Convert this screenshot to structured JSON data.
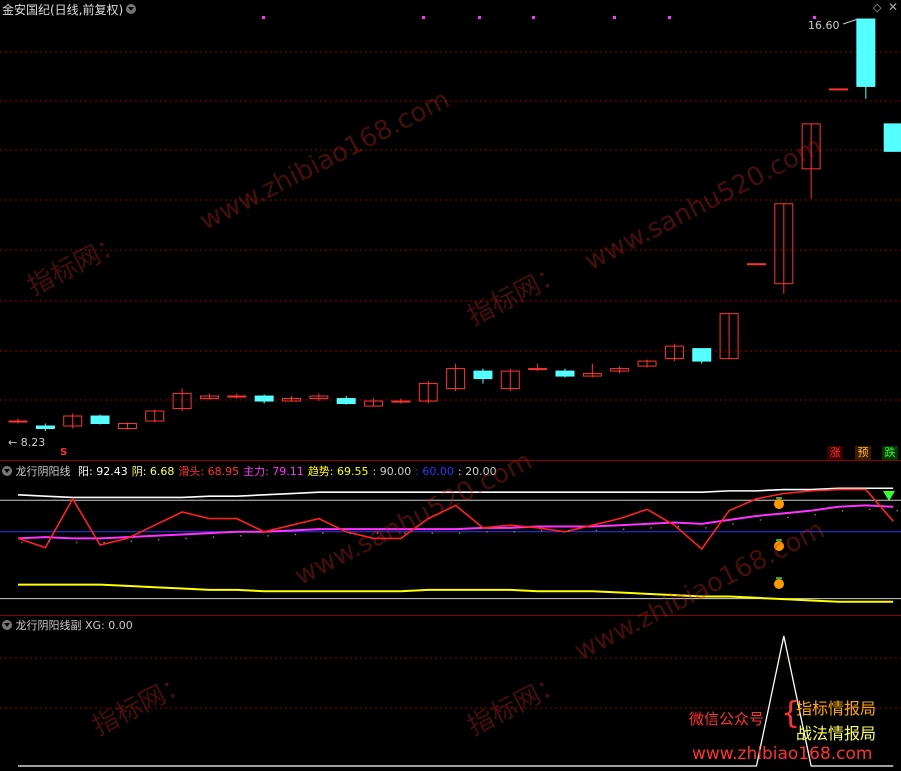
{
  "header": {
    "title": "金安国纪(日线,前复权)",
    "max_price_label": "16.60",
    "min_price_label": "8.23"
  },
  "tags": {
    "zhang": "涨",
    "yu": "预",
    "die": "跌"
  },
  "buy_marker": "S",
  "indicator1": {
    "name": "龙行阴阳线",
    "items": [
      {
        "key": "阳",
        "label": "阳: ",
        "value": "92.43",
        "color": "#ffffff"
      },
      {
        "key": "阴",
        "label": "阴: ",
        "value": "6.68",
        "color": "#ffff66"
      },
      {
        "key": "滑头",
        "label": "滑头: ",
        "value": "68.95",
        "color": "#ff3333"
      },
      {
        "key": "主力",
        "label": "主力: ",
        "value": "79.11",
        "color": "#ff33ff"
      },
      {
        "key": "趋势",
        "label": "趋势: ",
        "value": "69.55",
        "color": "#ffff00"
      },
      {
        "key": "l90",
        "label": ": ",
        "value": "90.00",
        "color": "#cccccc"
      },
      {
        "key": "l60",
        "label": ": ",
        "value": "60.00",
        "color": "#3333ff"
      },
      {
        "key": "l20",
        "label": ": ",
        "value": "20.00",
        "color": "#cccccc"
      }
    ]
  },
  "indicator2": {
    "name": "龙行阴阳线副",
    "xg_label": "XG: ",
    "xg_value": "0.00"
  },
  "promo": {
    "wechat": "微信公众号",
    "brace": "{",
    "line1": "指标情报局",
    "line2": "战法情报局",
    "url": "www.zhibiao168.com"
  },
  "watermarks": [
    "www.zhibiao168.com",
    "指标网：",
    "www.sanhu520.com",
    "指标网：",
    "www.sanhu520.com",
    "www.zhibiao168.com",
    "指标网：",
    "指标网："
  ],
  "colors": {
    "up": "#ff3333",
    "down": "#54ffff",
    "grid": "#8b0000"
  },
  "chart_data": {
    "type": "candlestick",
    "ylim": [
      8.23,
      16.6
    ],
    "candles": [
      {
        "o": 8.55,
        "c": 8.55,
        "h": 8.6,
        "l": 8.5,
        "up": true
      },
      {
        "o": 8.45,
        "c": 8.4,
        "h": 8.5,
        "l": 8.35,
        "up": false
      },
      {
        "o": 8.45,
        "c": 8.65,
        "h": 8.7,
        "l": 8.4,
        "up": true
      },
      {
        "o": 8.65,
        "c": 8.5,
        "h": 8.68,
        "l": 8.48,
        "up": false
      },
      {
        "o": 8.4,
        "c": 8.5,
        "h": 8.52,
        "l": 8.38,
        "up": true
      },
      {
        "o": 8.55,
        "c": 8.75,
        "h": 8.78,
        "l": 8.52,
        "up": true
      },
      {
        "o": 8.8,
        "c": 9.1,
        "h": 9.2,
        "l": 8.75,
        "up": true
      },
      {
        "o": 9.0,
        "c": 9.05,
        "h": 9.1,
        "l": 8.98,
        "up": true
      },
      {
        "o": 9.05,
        "c": 9.05,
        "h": 9.1,
        "l": 9.0,
        "up": true
      },
      {
        "o": 9.05,
        "c": 8.95,
        "h": 9.08,
        "l": 8.9,
        "up": false
      },
      {
        "o": 8.95,
        "c": 9.0,
        "h": 9.05,
        "l": 8.95,
        "up": true
      },
      {
        "o": 9.0,
        "c": 9.05,
        "h": 9.1,
        "l": 8.95,
        "up": true
      },
      {
        "o": 9.0,
        "c": 8.9,
        "h": 9.05,
        "l": 8.88,
        "up": false
      },
      {
        "o": 8.85,
        "c": 8.95,
        "h": 9.0,
        "l": 8.85,
        "up": true
      },
      {
        "o": 8.95,
        "c": 8.95,
        "h": 9.0,
        "l": 8.9,
        "up": true
      },
      {
        "o": 8.95,
        "c": 9.3,
        "h": 9.35,
        "l": 8.9,
        "up": true
      },
      {
        "o": 9.2,
        "c": 9.6,
        "h": 9.7,
        "l": 9.15,
        "up": true
      },
      {
        "o": 9.55,
        "c": 9.4,
        "h": 9.6,
        "l": 9.3,
        "up": false
      },
      {
        "o": 9.2,
        "c": 9.55,
        "h": 9.6,
        "l": 9.15,
        "up": true
      },
      {
        "o": 9.6,
        "c": 9.6,
        "h": 9.7,
        "l": 9.55,
        "up": true
      },
      {
        "o": 9.55,
        "c": 9.45,
        "h": 9.6,
        "l": 9.42,
        "up": false
      },
      {
        "o": 9.45,
        "c": 9.5,
        "h": 9.7,
        "l": 9.42,
        "up": true
      },
      {
        "o": 9.55,
        "c": 9.6,
        "h": 9.65,
        "l": 9.5,
        "up": true
      },
      {
        "o": 9.65,
        "c": 9.75,
        "h": 9.78,
        "l": 9.62,
        "up": true
      },
      {
        "o": 9.8,
        "c": 10.05,
        "h": 10.1,
        "l": 9.75,
        "up": true
      },
      {
        "o": 10.0,
        "c": 9.75,
        "h": 10.0,
        "l": 9.7,
        "up": false
      },
      {
        "o": 9.8,
        "c": 10.7,
        "h": 10.7,
        "l": 9.8,
        "up": true
      },
      {
        "o": 11.7,
        "c": 11.7,
        "h": 11.7,
        "l": 11.7,
        "up": true
      },
      {
        "o": 11.3,
        "c": 12.9,
        "h": 12.9,
        "l": 11.1,
        "up": true
      },
      {
        "o": 13.6,
        "c": 14.5,
        "h": 14.5,
        "l": 13.0,
        "up": true
      },
      {
        "o": 15.2,
        "c": 15.2,
        "h": 15.2,
        "l": 15.2,
        "up": true
      },
      {
        "o": 16.6,
        "c": 15.25,
        "h": 16.6,
        "l": 15.0,
        "up": false
      },
      {
        "o": 14.5,
        "c": 13.95,
        "h": 14.5,
        "l": 13.95,
        "up": false
      }
    ],
    "ind1_series": {
      "white": [
        88,
        87,
        86,
        86,
        86,
        86,
        86,
        87,
        87,
        88,
        89,
        90,
        90,
        90,
        90,
        90,
        90,
        90,
        90,
        90,
        90,
        90,
        90,
        90,
        90,
        90,
        91,
        91,
        92,
        92,
        93,
        93,
        93
      ],
      "red": [
        55,
        48,
        85,
        50,
        55,
        65,
        75,
        70,
        70,
        60,
        65,
        70,
        60,
        55,
        55,
        70,
        80,
        63,
        65,
        63,
        60,
        65,
        70,
        77,
        65,
        47,
        76,
        85,
        89,
        91,
        92,
        92,
        68
      ],
      "magenta": [
        55,
        56,
        55,
        55,
        56,
        57,
        58,
        59,
        60,
        60,
        61,
        62,
        62,
        62,
        62,
        62,
        62,
        63,
        63,
        64,
        64,
        64,
        65,
        66,
        67,
        66,
        69,
        72,
        74,
        76,
        79,
        80,
        79
      ],
      "yellow": [
        20,
        20,
        20,
        20,
        19,
        18,
        17,
        16,
        16,
        15,
        15,
        15,
        15,
        15,
        15,
        16,
        16,
        16,
        16,
        15,
        15,
        15,
        14,
        13,
        12,
        11,
        11,
        10,
        9,
        8,
        7,
        7,
        7
      ]
    },
    "ind2_series": {
      "xg": [
        0,
        0,
        0,
        0,
        0,
        0,
        0,
        0,
        0,
        0,
        0,
        0,
        0,
        0,
        0,
        0,
        0,
        0,
        0,
        0,
        0,
        0,
        0,
        0,
        0,
        0,
        0,
        0,
        100,
        0,
        0,
        0,
        0
      ]
    }
  }
}
